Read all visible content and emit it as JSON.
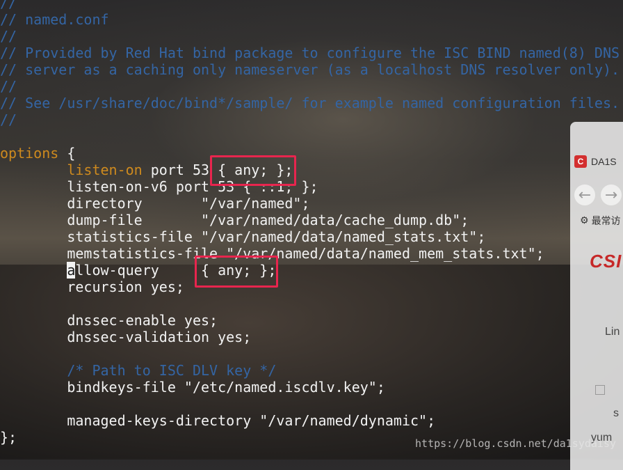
{
  "editor": {
    "lines": [
      {
        "cls": "c-comment",
        "text": "//"
      },
      {
        "cls": "c-comment",
        "text": "// named.conf"
      },
      {
        "cls": "c-comment",
        "text": "//"
      },
      {
        "cls": "c-comment",
        "text": "// Provided by Red Hat bind package to configure the ISC BIND named(8) DNS"
      },
      {
        "cls": "c-comment",
        "text": "// server as a caching only nameserver (as a localhost DNS resolver only)."
      },
      {
        "cls": "c-comment",
        "text": "//"
      },
      {
        "cls": "c-comment",
        "text": "// See /usr/share/doc/bind*/sample/ for example named configuration files."
      },
      {
        "cls": "c-comment",
        "text": "//"
      },
      {
        "cls": "c-text",
        "text": ""
      }
    ],
    "options_keyword": "options",
    "options_open": " {",
    "listen_on_keyword": "listen-on",
    "listen_on_rest": " port 53 { any; };",
    "listen_on_v6": "        listen-on-v6 port 53 { ::1; };",
    "directory": "        directory       \"/var/named\";",
    "dump_file": "        dump-file       \"/var/named/data/cache_dump.db\";",
    "statistics_file": "        statistics-file \"/var/named/data/named_stats.txt\";",
    "memstatistics_file": "        memstatistics-file \"/var/named/data/named_mem_stats.txt\";",
    "allow_query_cursor": "a",
    "allow_query_rest": "llow-query     { any; };",
    "recursion": "        recursion yes;",
    "dnssec_enable": "        dnssec-enable yes;",
    "dnssec_validation": "        dnssec-validation yes;",
    "dlv_comment": "        /* Path to ISC DLV key */",
    "bindkeys_file": "        bindkeys-file \"/etc/named.iscdlv.key\";",
    "managed_keys": "        managed-keys-directory \"/var/named/dynamic\";",
    "close": "};"
  },
  "browser": {
    "tab_title": "DA1S",
    "tab_icon_letter": "C",
    "back_glyph": "←",
    "forward_glyph": "→",
    "bookmarks_label": "最常访",
    "logo": "CSI",
    "side_text_1": "Lin",
    "side_text_2": "s",
    "side_text_3": "yum"
  },
  "watermark": "https://blog.csdn.net/da1sydaisy",
  "colors": {
    "comment": "#3465a4",
    "keyword": "#ce8a1e",
    "text": "#f2f2f2",
    "highlight": "#e8254e"
  }
}
